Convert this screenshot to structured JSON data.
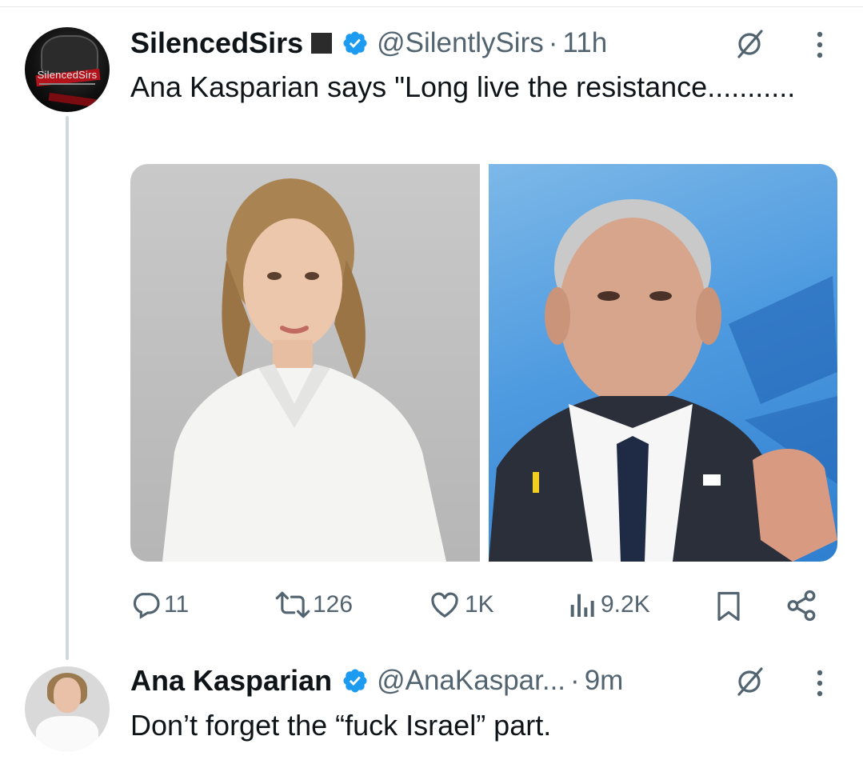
{
  "tweet": {
    "display_name": "SilencedSirs",
    "handle": "@SilentlySirs",
    "separator": "·",
    "time": "11h",
    "text": "Ana Kasparian says \"Long live the resistance...........",
    "avatar_label": "SilencedSirs",
    "stats": {
      "replies": "11",
      "reposts": "126",
      "likes": "1K",
      "views": "9.2K"
    }
  },
  "reply": {
    "display_name": "Ana Kasparian",
    "handle": "@AnaKaspar...",
    "separator": "·",
    "time": "9m",
    "text": "Don’t forget the “fuck Israel” part."
  },
  "colors": {
    "verified_blue": "#1d9bf0",
    "muted_text": "#536471",
    "thread_line": "#cfd9de"
  },
  "icons": [
    "verified-badge-icon",
    "grok-icon",
    "more-options-icon",
    "reply-icon",
    "repost-icon",
    "like-icon",
    "views-icon",
    "bookmark-icon",
    "share-icon"
  ]
}
